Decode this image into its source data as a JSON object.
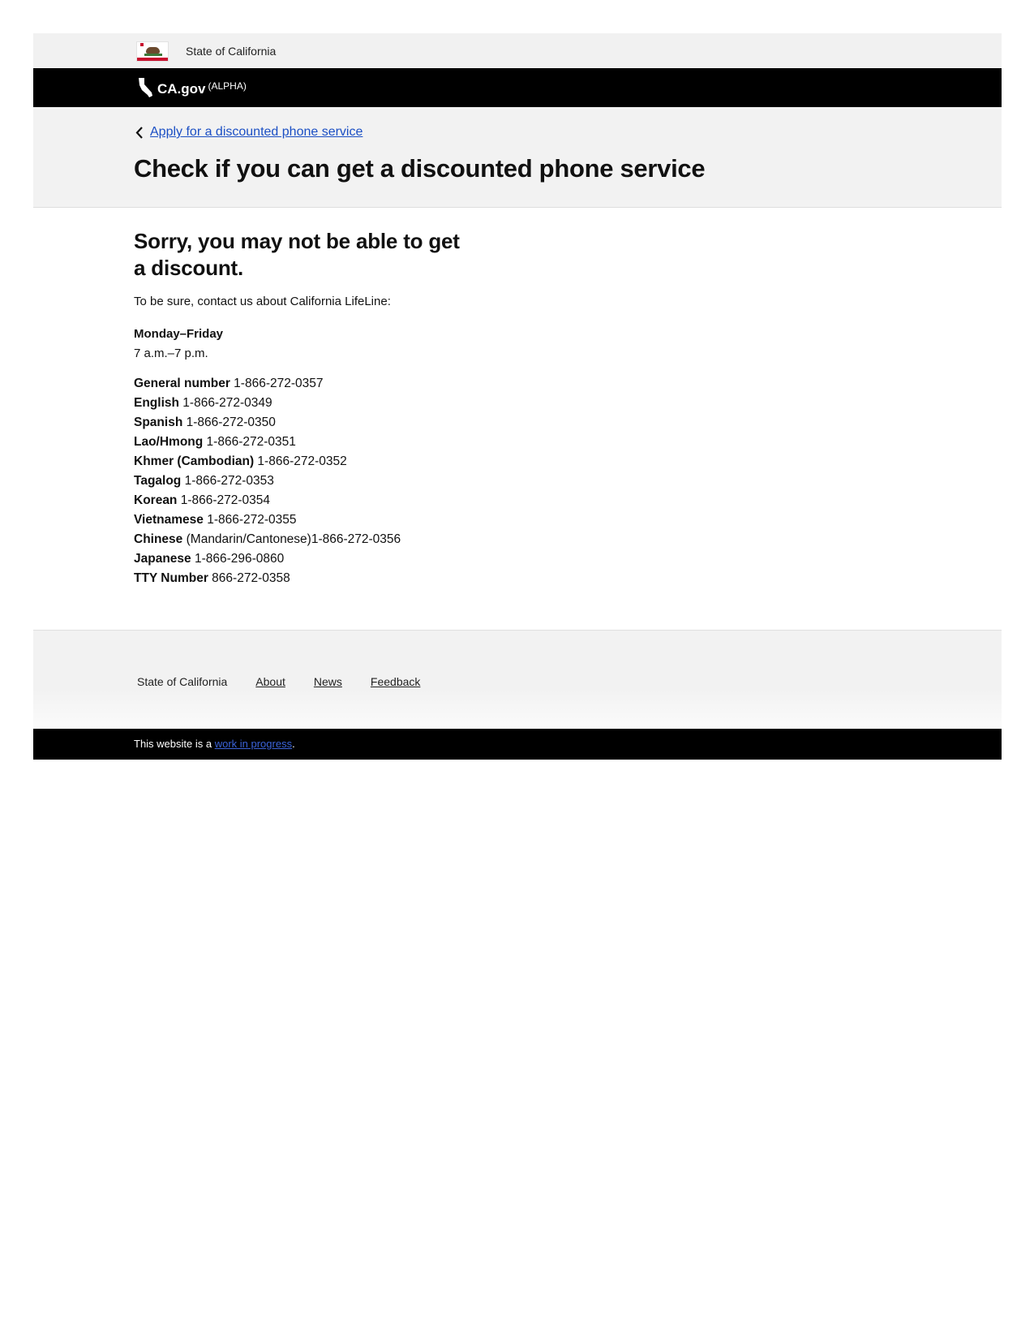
{
  "state_bar": {
    "flag_icon": "california-flag-icon",
    "label": "State of California"
  },
  "cagov_bar": {
    "logo_icon": "california-outline-icon",
    "logo_text": "CA.gov",
    "badge": "(ALPHA)"
  },
  "page_header": {
    "back_icon": "chevron-left-icon",
    "back_link": "Apply for a discounted phone service",
    "title": "Check if you can get a discounted phone service"
  },
  "result": {
    "heading": "Sorry, you may not be able to get a discount.",
    "intro": "To be sure, contact us about California LifeLine:",
    "days": "Monday–Friday",
    "hours": "7 a.m.–7 p.m.",
    "phones": [
      {
        "label": "General number",
        "number": " 1-866-272-0357"
      },
      {
        "label": "English",
        "number": " 1-866-272-0349"
      },
      {
        "label": "Spanish",
        "number": " 1-866-272-0350"
      },
      {
        "label": "Lao/Hmong",
        "number": " 1-866-272-0351"
      },
      {
        "label": "Khmer (Cambodian)",
        "number": " 1-866-272-0352"
      },
      {
        "label": "Tagalog",
        "number": " 1-866-272-0353"
      },
      {
        "label": "Korean",
        "number": " 1-866-272-0354"
      },
      {
        "label": "Vietnamese",
        "number": " 1-866-272-0355"
      },
      {
        "label": "Chinese",
        "number": " (Mandarin/Cantonese)1-866-272-0356"
      },
      {
        "label": "Japanese",
        "number": " 1-866-296-0860"
      },
      {
        "label": "TTY Number",
        "number": " 866-272-0358"
      }
    ]
  },
  "footer": {
    "state": "State of California",
    "about": "About",
    "news": "News",
    "feedback": "Feedback"
  },
  "wip_bar": {
    "prefix": "This website is a ",
    "link": "work in progress",
    "suffix": "."
  },
  "colors": {
    "link": "#1b4fc4",
    "header_black": "#000000",
    "band_gray": "#f2f2f2"
  }
}
